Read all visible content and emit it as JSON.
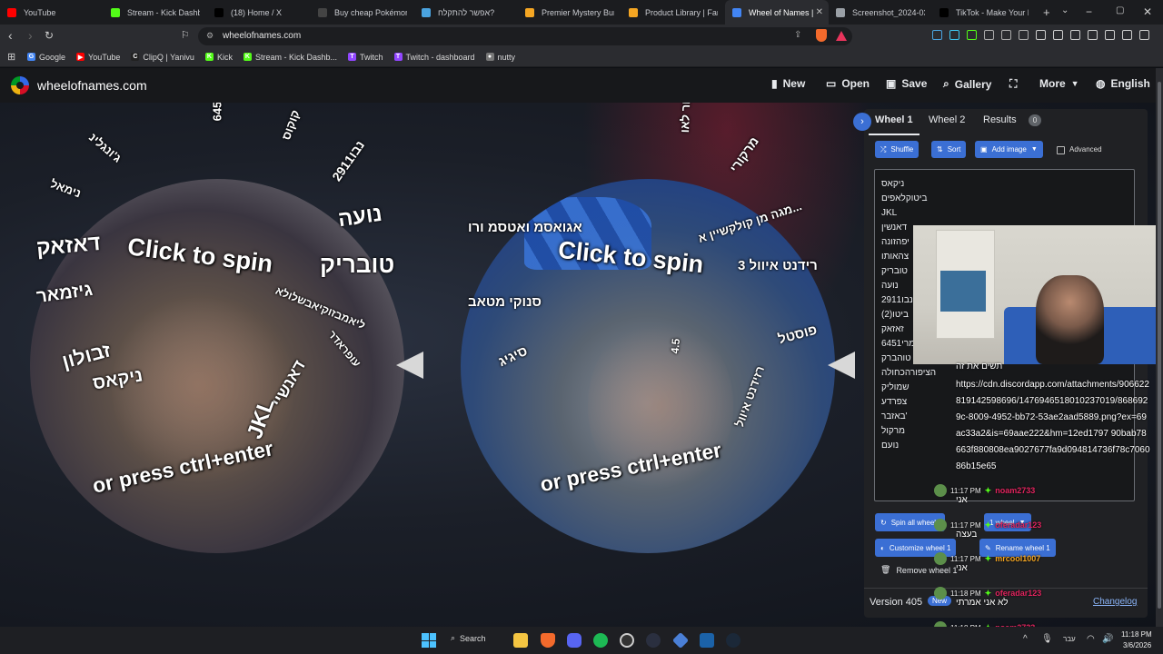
{
  "browser": {
    "tabs": [
      {
        "label": "YouTube",
        "icon": "youtube-icon",
        "color": "#ff0000"
      },
      {
        "label": "Stream - Kick Dashboa",
        "icon": "kick-icon",
        "color": "#53fc18"
      },
      {
        "label": "(18) Home / X",
        "icon": "x-icon",
        "color": "#000000"
      },
      {
        "label": "Buy cheap Pokémon P",
        "icon": "gg-icon",
        "color": "#444444"
      },
      {
        "label": "אפשר להתקלח?",
        "icon": "page-icon",
        "color": "#4aa3df"
      },
      {
        "label": "Premier Mystery Bundl",
        "icon": "fanatical-icon",
        "color": "#f5a623"
      },
      {
        "label": "Product Library | Fanati",
        "icon": "fanatical-icon",
        "color": "#f5a623"
      },
      {
        "label": "Wheel of Names |",
        "icon": "wheel-icon",
        "color": "#4285f4"
      },
      {
        "label": "Screenshot_2024-03-0",
        "icon": "globe-icon",
        "color": "#9aa0a6"
      },
      {
        "label": "TikTok - Make Your Da",
        "icon": "tiktok-icon",
        "color": "#000000"
      }
    ],
    "new_tab": "+",
    "url": "wheelofnames.com",
    "bookmarks": [
      {
        "label": "Google",
        "color": "#4285f4",
        "glyph": "G"
      },
      {
        "label": "YouTube",
        "color": "#ff0000",
        "glyph": "▶"
      },
      {
        "label": "ClipQ | Yanivu",
        "color": "#222222",
        "glyph": "C"
      },
      {
        "label": "Kick",
        "color": "#53fc18",
        "glyph": "K"
      },
      {
        "label": "Stream - Kick Dashb...",
        "color": "#53fc18",
        "glyph": "K"
      },
      {
        "label": "Twitch",
        "color": "#9146ff",
        "glyph": "T"
      },
      {
        "label": "Twitch - dashboard",
        "color": "#9146ff",
        "glyph": "T"
      },
      {
        "label": "nutty",
        "color": "#777777",
        "glyph": "●"
      }
    ]
  },
  "site": {
    "logo_text": "wheelofnames.com",
    "nav": [
      {
        "label": "New",
        "icon": "file-icon"
      },
      {
        "label": "Open",
        "icon": "folder-icon"
      },
      {
        "label": "Save",
        "icon": "save-icon"
      },
      {
        "label": "Gallery",
        "icon": "search-icon"
      },
      {
        "label": "",
        "icon": "fullscreen-icon"
      },
      {
        "label": "More",
        "icon": "chevron-down-icon"
      },
      {
        "label": "English",
        "icon": "globe-icon"
      }
    ]
  },
  "wheel_left": {
    "click_to_spin": "Click to spin",
    "or_press": "or press ctrl+enter",
    "labels": [
      {
        "text": "טובריק",
        "size": 26
      },
      {
        "text": "נועה",
        "size": 24
      },
      {
        "text": "נבו2911",
        "size": 14
      },
      {
        "text": "קוקוס",
        "size": 13
      },
      {
        "text": "דאזאק",
        "size": 24
      },
      {
        "text": "עמרי6451",
        "size": 13
      },
      {
        "text": "ג'ונגלינ",
        "size": 13
      },
      {
        "text": "נימאל",
        "size": 13
      },
      {
        "text": "זבולון",
        "size": 22
      },
      {
        "text": "גיזמאר",
        "size": 20
      },
      {
        "text": "ניקאס",
        "size": 20
      },
      {
        "text": "ליאמבזוקיאבשלולא",
        "size": 12
      },
      {
        "text": "עופראדר",
        "size": 12
      },
      {
        "text": "דאנשיי",
        "size": 18
      },
      {
        "text": "JKL",
        "size": 24
      }
    ]
  },
  "wheel_right": {
    "click_to_spin": "Click to spin",
    "or_press": "or press ctrl+enter",
    "labels": [
      {
        "text": "רידנט איוול 3",
        "size": 15
      },
      {
        "text": "מגה מן קולקשיין א...",
        "size": 13
      },
      {
        "text": "מרקורי",
        "size": 14
      },
      {
        "text": "מוב אור לאו",
        "size": 13
      },
      {
        "text": "פוסטל",
        "size": 15
      },
      {
        "text": "רזידנט איוול",
        "size": 13
      },
      {
        "text": "4.5",
        "size": 12
      },
      {
        "text": "אגואסמ ואטסמ ורו",
        "size": 15
      },
      {
        "text": "סנוקי מטאב",
        "size": 15
      },
      {
        "text": "סיגיג",
        "size": 15
      }
    ]
  },
  "panel": {
    "tabs": [
      {
        "label": "Wheel 1"
      },
      {
        "label": "Wheel 2"
      },
      {
        "label": "Results",
        "badge": "0"
      }
    ],
    "buttons": {
      "shuffle": "Shuffle",
      "sort": "Sort",
      "add_image": "Add image",
      "advanced": "Advanced"
    },
    "entries": [
      "ניקאס",
      "ביטוקלאפים",
      "JKL",
      "דאנשין",
      "יפהזונה",
      "צהאותו",
      "טובריק",
      "נועה",
      "נבו2911",
      "(ביטו(2",
      "זאזאק",
      "עמרי6451",
      "טוהברק",
      "הציפורהכחולה",
      "שמוליק",
      "צפרדע",
      "באזבר'",
      "מרקול",
      "נועם"
    ],
    "overlay_message": "תשים את זה",
    "overlay_url": "https://cdn.discordapp.com/attachments/906622819142598696/1476946518010237019/8686929c-8009-4952-bb72-53ae2aad5889.png?ex=69ac33a2&is=69aae222&hm=12ed1797 90bab78663f880808ea9027677fa9d094814736f78c706086b15e65",
    "actions": {
      "spin_all": "Spin all wheels",
      "wheel_select": "1 wheel",
      "customize": "Customize wheel 1",
      "rename": "Rename wheel 1",
      "remove": "Remove wheel 1"
    },
    "version": "Version 405",
    "new_badge": "New",
    "changelog": "Changelog"
  },
  "chat": [
    {
      "time": "11:17 PM",
      "user": "noam2733",
      "color": "#e0245e",
      "msg": "אני"
    },
    {
      "time": "11:17 PM",
      "user": "oferadar123",
      "color": "#e0245e",
      "msg": "בעצה"
    },
    {
      "time": "11:17 PM",
      "user": "mrcool1007",
      "color": "#f5a623",
      "msg": "אני"
    },
    {
      "time": "11:18 PM",
      "user": "oferadar123",
      "color": "#e0245e",
      "msg": "לא אני אמרתי"
    },
    {
      "time": "11:18 PM",
      "user": "noam2733",
      "color": "#e0245e",
      "msg": "אותי"
    }
  ],
  "taskbar": {
    "search": "Search",
    "time": "11:18 PM",
    "date": "3/6/2026",
    "lang": "עבר"
  }
}
